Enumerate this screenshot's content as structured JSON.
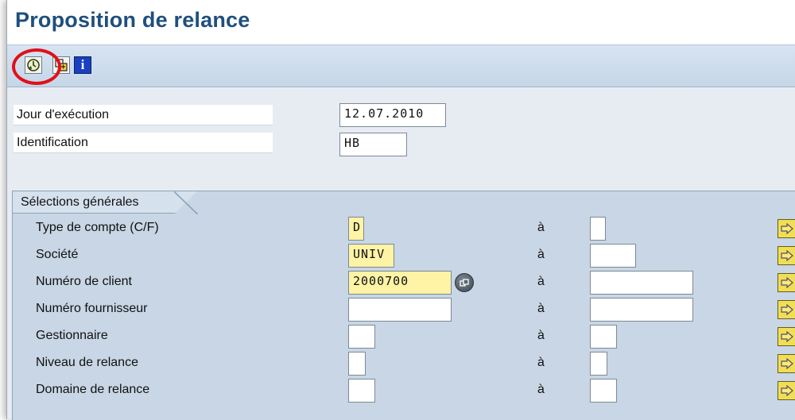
{
  "title": "Proposition de relance",
  "toolbar": {
    "execute_icon": "execute-clock-icon",
    "variant_icon": "get-variant-icon",
    "info_icon": "info-icon",
    "info_label": "i"
  },
  "header_fields": {
    "execution_day": {
      "label": "Jour d'exécution",
      "value": "12.07.2010"
    },
    "identification": {
      "label": "Identification",
      "value": "HB"
    }
  },
  "selections": {
    "title": "Sélections générales",
    "to_label": "à",
    "rows": [
      {
        "label": "Type de compte (C/F)",
        "from": "D",
        "to": ""
      },
      {
        "label": "Société",
        "from": "UNIV",
        "to": ""
      },
      {
        "label": "Numéro de client",
        "from": "2000700",
        "to": ""
      },
      {
        "label": "Numéro fournisseur",
        "from": "",
        "to": ""
      },
      {
        "label": "Gestionnaire",
        "from": "",
        "to": ""
      },
      {
        "label": "Niveau de relance",
        "from": "",
        "to": ""
      },
      {
        "label": "Domaine de relance",
        "from": "",
        "to": ""
      }
    ]
  },
  "colors": {
    "title": "#1f4f7d",
    "required_field": "#fff3a6",
    "highlight": "#e0101a",
    "arrow_button": "#f0df55"
  }
}
